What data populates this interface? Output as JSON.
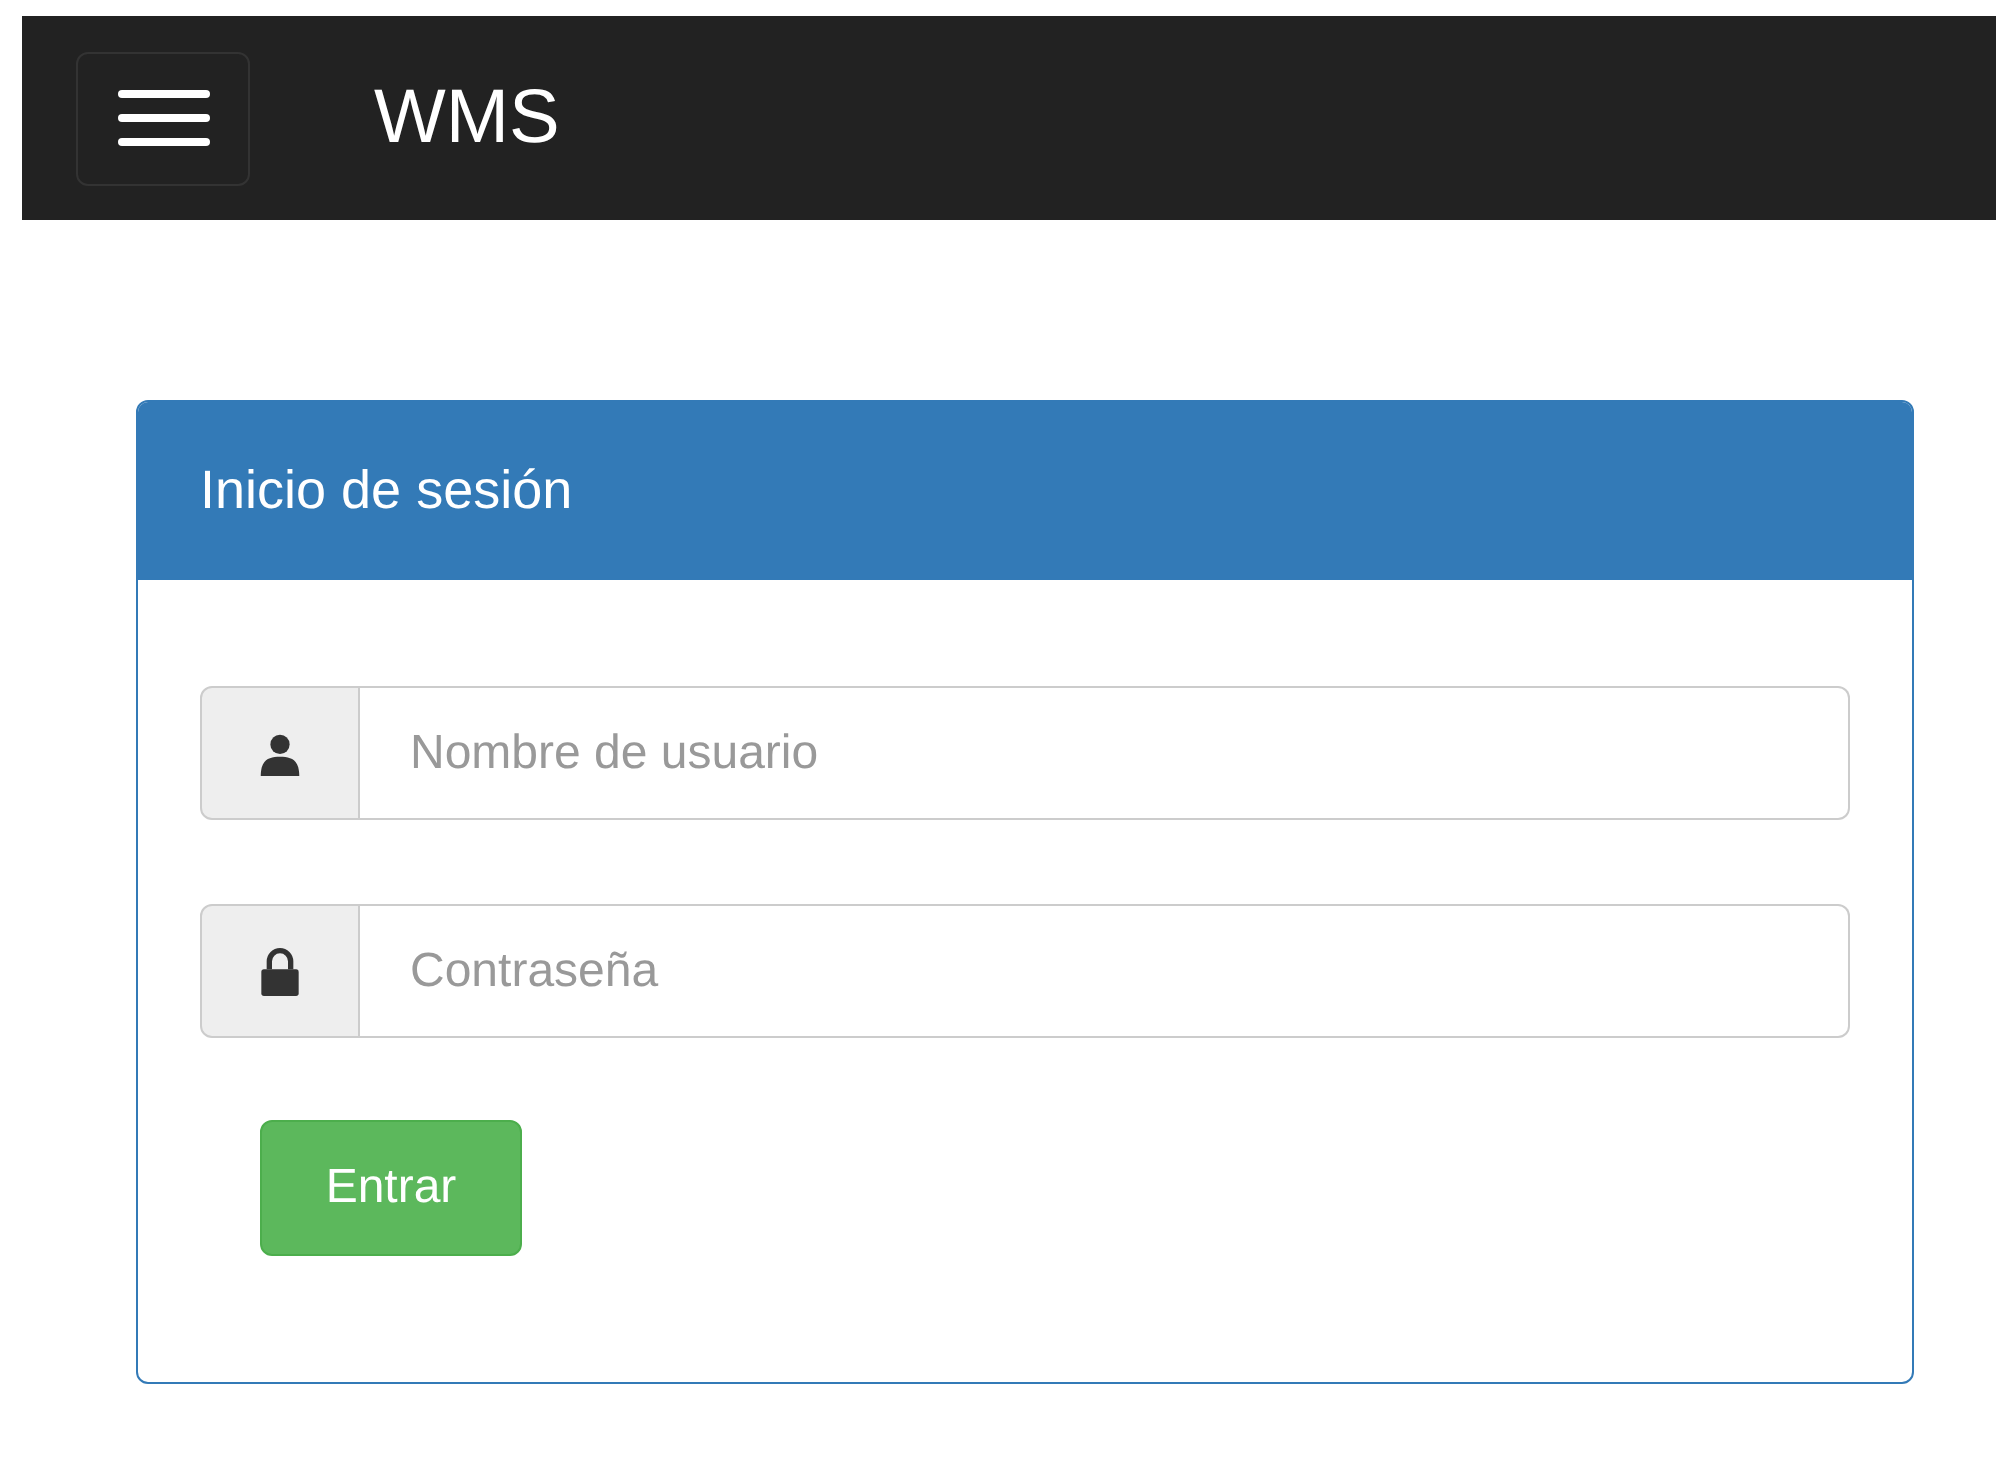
{
  "navbar": {
    "brand": "WMS"
  },
  "panel": {
    "title": "Inicio de sesión",
    "fields": [
      {
        "kind": "user",
        "placeholder": "Nombre de usuario"
      },
      {
        "kind": "lock",
        "placeholder": "Contraseña"
      }
    ],
    "submit": "Entrar"
  }
}
